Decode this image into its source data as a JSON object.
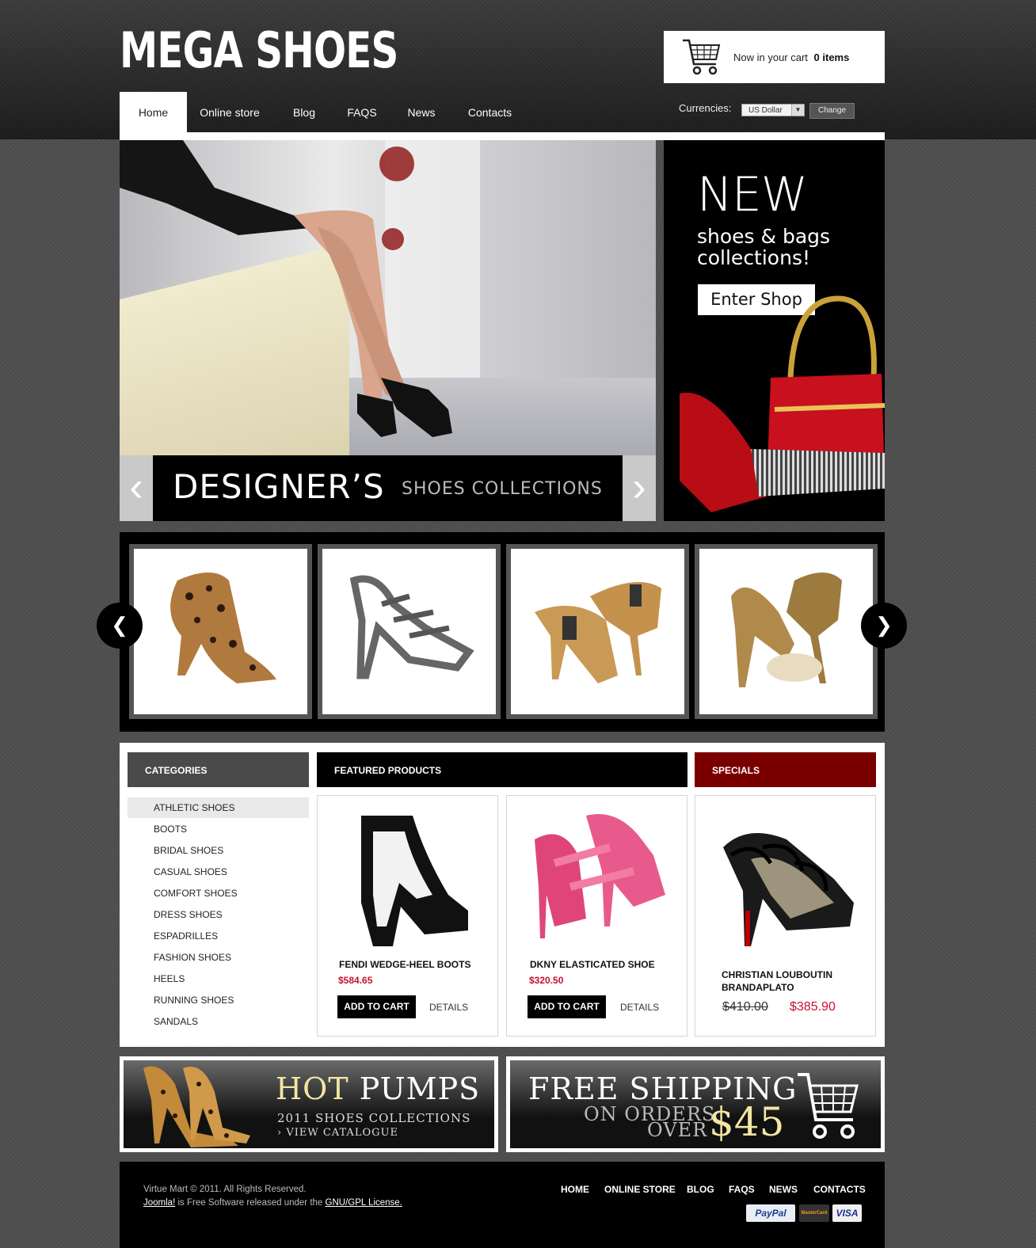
{
  "brand": {
    "logo": "MEGA SHOES"
  },
  "cart": {
    "label": "Now in your cart",
    "count": "0 items",
    "icon": "shopping-cart-icon"
  },
  "nav": {
    "items": [
      "Home",
      "Online store",
      "Blog",
      "FAQS",
      "News",
      "Contacts"
    ],
    "active": "Home"
  },
  "currency": {
    "label": "Currencies:",
    "selected": "US Dollar",
    "change_label": "Change"
  },
  "hero": {
    "title": "DESIGNER’S",
    "subtitle": "SHOES COLLECTIONS",
    "prev_icon": "chevron-left-icon",
    "next_icon": "chevron-right-icon"
  },
  "promo": {
    "headline": "NEW",
    "subtext": "shoes & bags collections!",
    "button": "Enter Shop"
  },
  "carousel": {
    "prev_icon": "chevron-left-icon",
    "next_icon": "chevron-right-icon"
  },
  "categories": {
    "header": "CATEGORIES",
    "items": [
      "ATHLETIC SHOES",
      "BOOTS",
      "BRIDAL SHOES",
      "CASUAL SHOES",
      "COMFORT SHOES",
      "DRESS SHOES",
      "ESPADRILLES",
      "FASHION SHOES",
      "HEELS",
      "RUNNING SHOES",
      "SANDALS"
    ],
    "selected": "ATHLETIC SHOES"
  },
  "featured": {
    "header": "FEATURED PRODUCTS",
    "products": [
      {
        "name": "FENDI WEDGE-HEEL  BOOTS",
        "price": "$584.65",
        "add_label": "ADD TO CART",
        "details_label": "DETAILS"
      },
      {
        "name": "DKNY ELASTICATED SHOE",
        "price": "$320.50",
        "add_label": "ADD TO CART",
        "details_label": "DETAILS"
      }
    ]
  },
  "specials": {
    "header": "SPECIALS",
    "product": {
      "name_line1": "CHRISTIAN LOUBOUTIN",
      "name_line2": "BRANDAPLATO",
      "old_price": "$410.00",
      "new_price": "$385.90"
    }
  },
  "banners": {
    "hot": {
      "word1": "HOT",
      "word2": "PUMPS",
      "line1": "2011 SHOES COLLECTIONS",
      "link": "VIEW CATALOGUE"
    },
    "shipping": {
      "title": "FREE SHIPPING",
      "line1": "ON ORDERS",
      "line2": "OVER",
      "amount": "$45"
    }
  },
  "footer": {
    "copyright": "Virtue Mart © 2011.  All Rights Reserved.",
    "joomla": "Joomla!",
    "free_text": "is Free Software released under the",
    "license": "GNU/GPL License.",
    "nav": [
      "HOME",
      "ONLINE STORE",
      "BLOG",
      "FAQS",
      "NEWS",
      "CONTACTS"
    ],
    "payments": [
      "PayPal",
      "MasterCard",
      "VISA"
    ]
  },
  "colors": {
    "specials_header": "#7a0000",
    "price_red": "#c8102e",
    "dark": "#000000",
    "page_bg": "#4e4e4e"
  }
}
